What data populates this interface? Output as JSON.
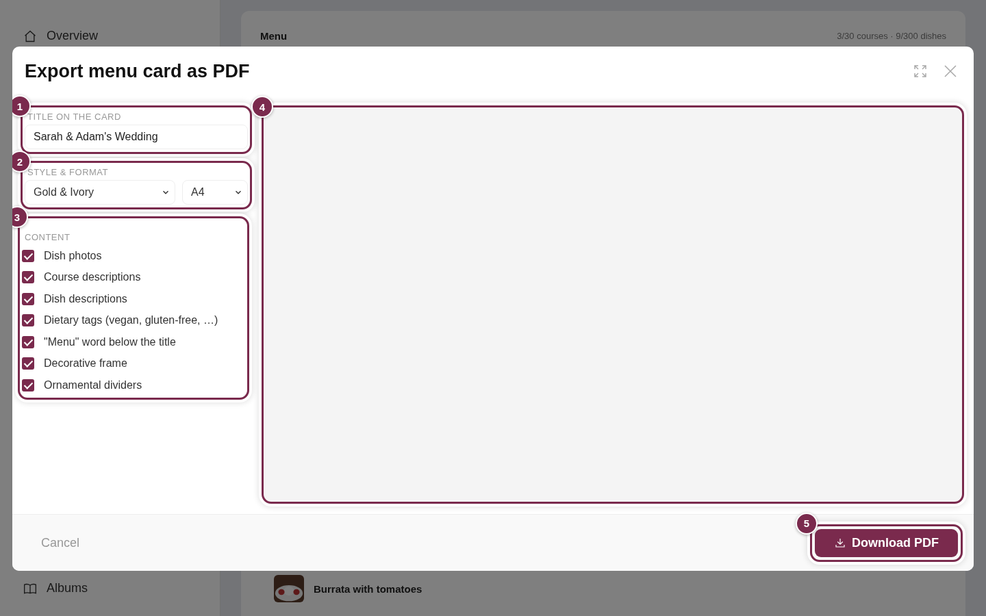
{
  "background": {
    "sidebar": {
      "items": [
        {
          "label": "Overview"
        },
        {
          "label": "Albums"
        }
      ]
    },
    "menu_panel": {
      "title": "Menu",
      "counts": "3/30 courses · 9/300 dishes",
      "dishes": [
        {
          "name": "Burrata with tomatoes"
        }
      ]
    }
  },
  "dialog": {
    "title": "Export menu card as PDF",
    "title_section": {
      "marker": "1",
      "label": "TITLE ON THE CARD",
      "value": "Sarah & Adam's Wedding"
    },
    "style_section": {
      "marker": "2",
      "label": "STYLE & FORMAT",
      "style": "Gold & Ivory",
      "format": "A4"
    },
    "content_section": {
      "marker": "3",
      "label": "CONTENT",
      "options": [
        {
          "label": "Dish photos",
          "checked": true
        },
        {
          "label": "Course descriptions",
          "checked": true
        },
        {
          "label": "Dish descriptions",
          "checked": true
        },
        {
          "label": "Dietary tags (vegan, gluten-free, …)",
          "checked": true
        },
        {
          "label": "\"Menu\" word below the title",
          "checked": true
        },
        {
          "label": "Decorative frame",
          "checked": true
        },
        {
          "label": "Ornamental dividers",
          "checked": true
        }
      ]
    },
    "preview": {
      "marker": "4"
    },
    "footer": {
      "cancel": "Cancel",
      "download": {
        "label": "Download PDF",
        "marker": "5"
      }
    }
  }
}
